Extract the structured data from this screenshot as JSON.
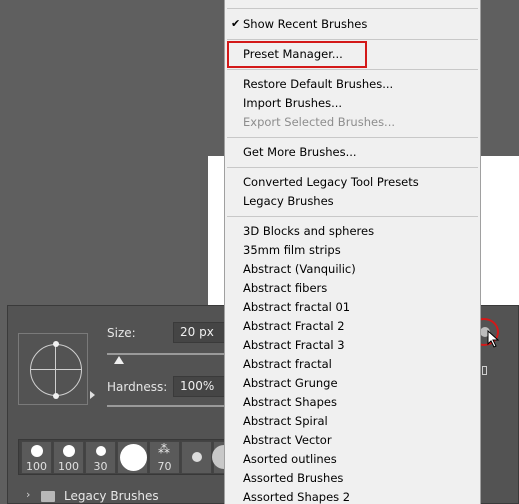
{
  "menu": {
    "items": [
      {
        "label": "Show Recent Brushes",
        "checked": true
      },
      {
        "label": "Preset Manager...",
        "highlighted": true
      },
      {
        "label": "Restore Default Brushes..."
      },
      {
        "label": "Import Brushes..."
      },
      {
        "label": "Export Selected Brushes...",
        "disabled": true
      },
      {
        "label": "Get More Brushes..."
      },
      {
        "label": "Converted Legacy Tool Presets"
      },
      {
        "label": "Legacy Brushes"
      },
      {
        "label": "3D Blocks and spheres"
      },
      {
        "label": "35mm film strips"
      },
      {
        "label": "Abstract (Vanquilic)"
      },
      {
        "label": "Abstract fibers"
      },
      {
        "label": "Abstract fractal 01"
      },
      {
        "label": "Abstract Fractal 2"
      },
      {
        "label": "Abstract Fractal 3"
      },
      {
        "label": "Abstract fractal"
      },
      {
        "label": "Abstract Grunge"
      },
      {
        "label": "Abstract Shapes"
      },
      {
        "label": "Abstract Spiral"
      },
      {
        "label": "Abstract Vector"
      },
      {
        "label": "Asorted outlines"
      },
      {
        "label": "Assorted Brushes"
      },
      {
        "label": "Assorted Shapes 2"
      }
    ],
    "check_glyph": "✔"
  },
  "brush_panel": {
    "size_label": "Size:",
    "size_value": "20 px",
    "hardness_label": "Hardness:",
    "hardness_value": "100%",
    "size_slider_fraction": 0.1,
    "tips": [
      {
        "size": "100"
      },
      {
        "size": "100"
      },
      {
        "size": "30"
      },
      {
        "size": ""
      },
      {
        "size": "70"
      },
      {
        "size": ""
      },
      {
        "size": ""
      }
    ],
    "folder_label": "Legacy Brushes"
  },
  "colors": {
    "highlight_red": "#d31919",
    "menu_bg": "#f0f0f0",
    "panel_bg": "#535353",
    "workspace_bg": "#5f5f5f"
  },
  "icons": [
    "checkmark-icon",
    "chevron-right-icon",
    "folder-icon",
    "gear-icon",
    "cursor-icon"
  ]
}
